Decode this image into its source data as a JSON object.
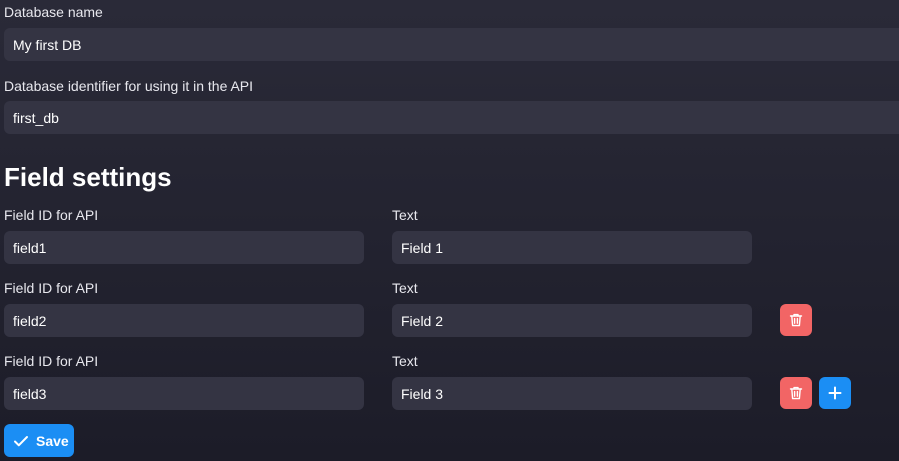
{
  "database": {
    "name_label": "Database name",
    "name_value": "My first DB",
    "identifier_label": "Database identifier for using it in the API",
    "identifier_value": "first_db"
  },
  "field_settings": {
    "heading": "Field settings",
    "fields": [
      {
        "id_label": "Field ID for API",
        "id_value": "field1",
        "text_label": "Text",
        "text_value": "Field 1"
      },
      {
        "id_label": "Field ID for API",
        "id_value": "field2",
        "text_label": "Text",
        "text_value": "Field 2"
      },
      {
        "id_label": "Field ID for API",
        "id_value": "field3",
        "text_label": "Text",
        "text_value": "Field 3"
      }
    ]
  },
  "actions": {
    "delete_icon": "trash-icon",
    "add_icon": "plus-icon",
    "save_label": "Save",
    "save_icon": "check-icon"
  },
  "colors": {
    "background": "#23232f",
    "input_background": "#343443",
    "delete": "#f26565",
    "primary": "#1b8ef4"
  }
}
